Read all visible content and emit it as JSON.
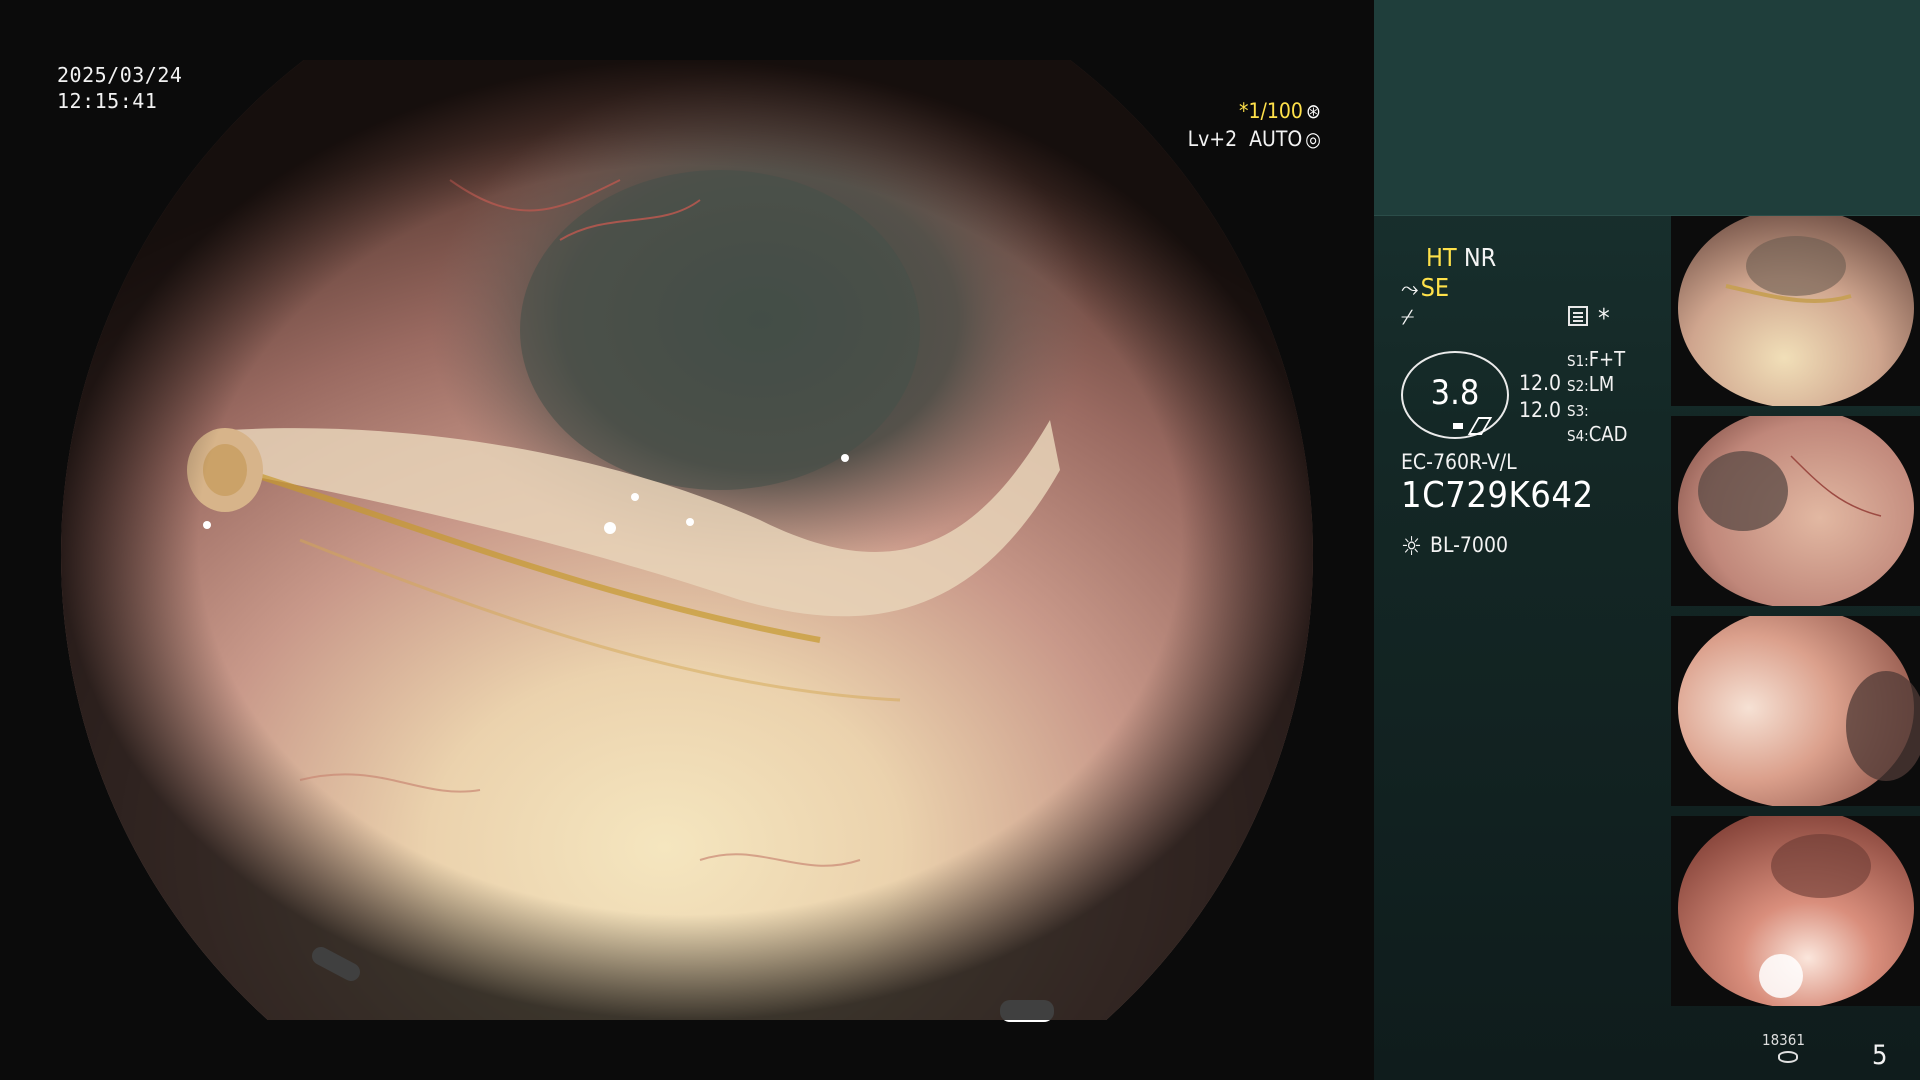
{
  "overlay": {
    "date": "2025/03/24",
    "time": "12:15:41",
    "shutter": "*1/100",
    "enhancement": "Lv+2  AUTO"
  },
  "panel": {
    "mode_ht": "HT",
    "mode_nr": "NR",
    "mode_se": "SE",
    "gauge_value": "3.8",
    "value1": "12.0",
    "value2": "12.0",
    "switches": [
      {
        "key": "S1:",
        "value": "F+T"
      },
      {
        "key": "S2:",
        "value": "LM"
      },
      {
        "key": "S3:",
        "value": ""
      },
      {
        "key": "S4:",
        "value": "CAD"
      }
    ],
    "scope_model": "EC-760R-V/L",
    "scope_serial": "1C729K642",
    "light_source": "BL-7000",
    "image_counter": "18361",
    "capture_count": "5"
  },
  "icons": {
    "shutter_icon": "aperture-icon",
    "auto_icon": "auto-exposure-icon",
    "scope_icon": "scope-icon",
    "signal_icon": "signal-icon",
    "menu_icon": "menu-icon",
    "light_icon": "sun-icon",
    "storage_icon": "disk-icon"
  },
  "colors": {
    "accent": "#ffe14a",
    "panel": "#1f3e3b"
  }
}
